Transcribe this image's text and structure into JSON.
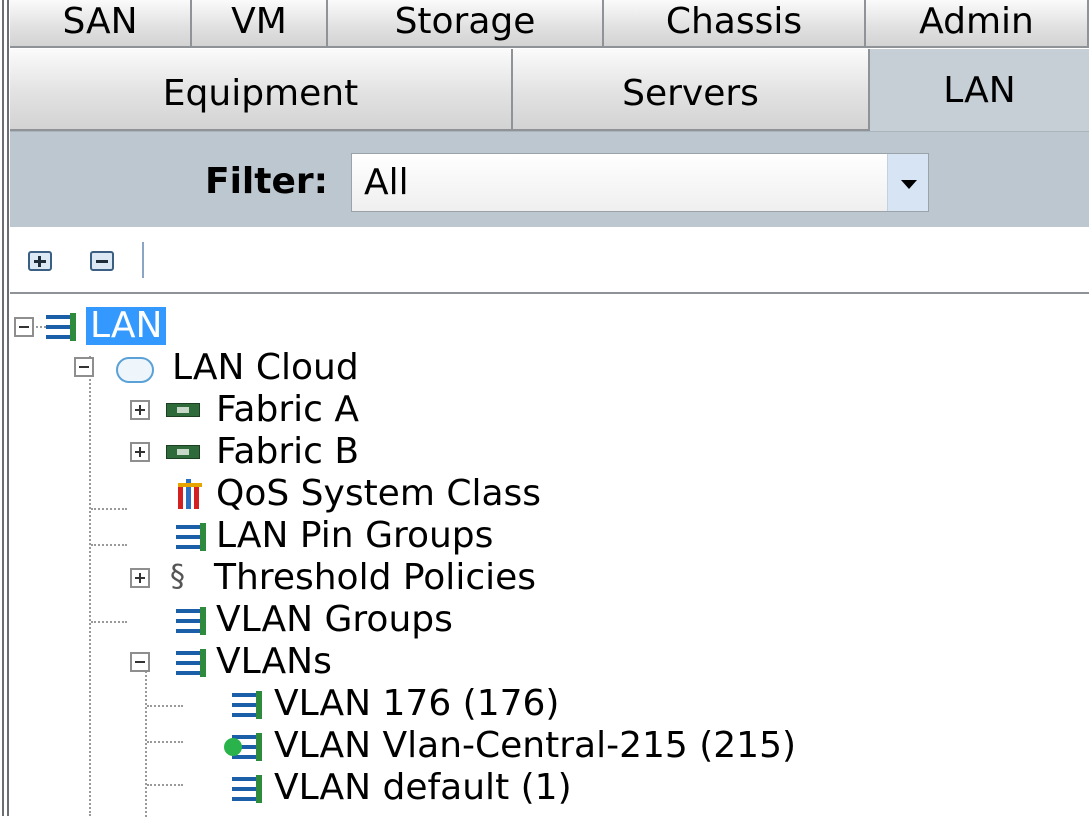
{
  "tabs": {
    "row1": [
      "SAN",
      "VM",
      "Storage",
      "Chassis",
      "Admin"
    ],
    "row2": [
      "Equipment",
      "Servers",
      "LAN"
    ],
    "active": "LAN"
  },
  "filter": {
    "label": "Filter:",
    "value": "All"
  },
  "toolbar": {
    "expand_icon": "expand-all-icon",
    "collapse_icon": "collapse-all-icon"
  },
  "tree": {
    "root": "LAN",
    "lan_cloud": "LAN Cloud",
    "fabric_a": "Fabric A",
    "fabric_b": "Fabric B",
    "qos": "QoS System Class",
    "pin_groups": "LAN Pin Groups",
    "threshold": "Threshold Policies",
    "vlan_groups": "VLAN Groups",
    "vlans": "VLANs",
    "vlan_items": [
      "VLAN 176 (176)",
      "VLAN Vlan-Central-215 (215)",
      "VLAN default (1)"
    ]
  },
  "colors": {
    "selection": "#3399ff",
    "filter_bar": "#bcc7cf",
    "vlan_status_dot": "#29b34a"
  }
}
